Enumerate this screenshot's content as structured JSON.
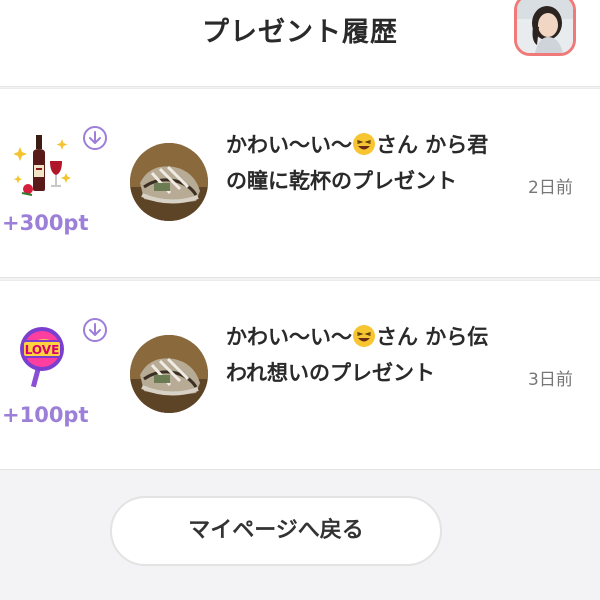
{
  "header": {
    "title": "プレゼント履歴",
    "avatar_icon": "user-avatar-icon"
  },
  "gifts": [
    {
      "gift_icon": "wine-bottle-gift-icon",
      "points": "+300pt",
      "message_line1_before_emoji": "かわい〜い〜",
      "message_emoji": "laughing-face-emoji",
      "message_after_emoji": "さん から君の瞳に乾杯のプレゼント",
      "time": "2日前"
    },
    {
      "gift_icon": "love-uchiwa-gift-icon",
      "points": "+100pt",
      "message_line1_before_emoji": "かわい〜い〜",
      "message_emoji": "laughing-face-emoji",
      "message_after_emoji": "さん から伝われ想いのプレゼント",
      "time": "3日前"
    }
  ],
  "back_button": {
    "label": "マイページへ戻る"
  },
  "colors": {
    "accent_purple": "#9b7fd8",
    "avatar_border": "#f07a7a",
    "background": "#f3f3f5"
  }
}
